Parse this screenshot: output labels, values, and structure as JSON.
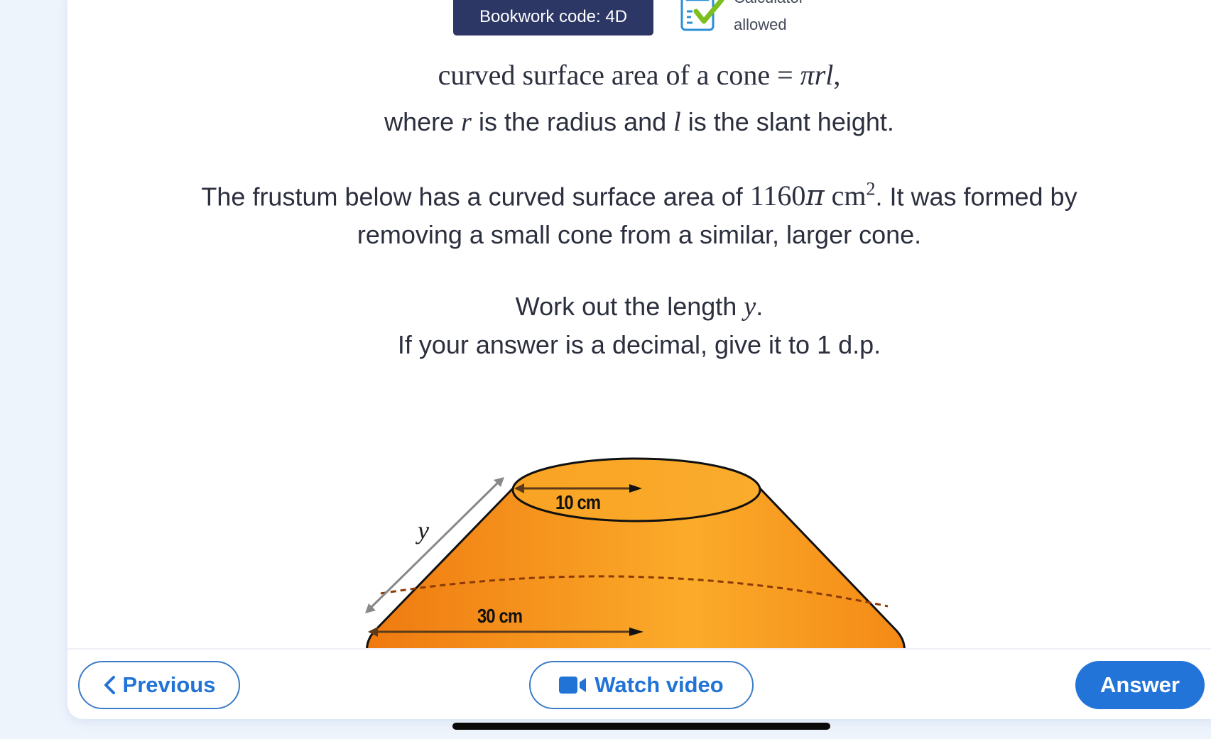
{
  "header": {
    "bookwork_code": "Bookwork code: 4D",
    "calculator_label_line1": "Calculator",
    "calculator_label_line2": "allowed",
    "calculator_icon": "calculator-check-icon"
  },
  "question": {
    "formula_text": "curved surface area of a cone",
    "formula_equals": " = ",
    "formula_pi": "π",
    "formula_r": "r",
    "formula_l": "l",
    "formula_comma": ",",
    "where_part1": "where ",
    "where_r": "r",
    "where_part2": " is the radius and ",
    "where_l": "l",
    "where_part3": " is the slant height.",
    "line1_part1": "The frustum below has a curved surface area of ",
    "line1_value": "1160",
    "line1_pi": "π",
    "line1_unit": " cm",
    "line1_exp": "2",
    "line1_part2": ". It was formed by",
    "line2": "removing a small cone from a similar, larger cone.",
    "task_part1": "Work out the length ",
    "task_var": "y",
    "task_part2": ".",
    "instruction": "If your answer is a decimal, give it to 1 d.p."
  },
  "diagram": {
    "shape": "frustum",
    "top_label": "10 cm",
    "bottom_label": "30 cm",
    "slant_label": "y",
    "colors": {
      "fill_dark": "#f07d12",
      "fill_light": "#fbab2a",
      "outline": "#111111"
    }
  },
  "footer": {
    "previous_label": "Previous",
    "watch_video_label": "Watch video",
    "answer_label": "Answer",
    "accent_color": "#2274d8"
  }
}
